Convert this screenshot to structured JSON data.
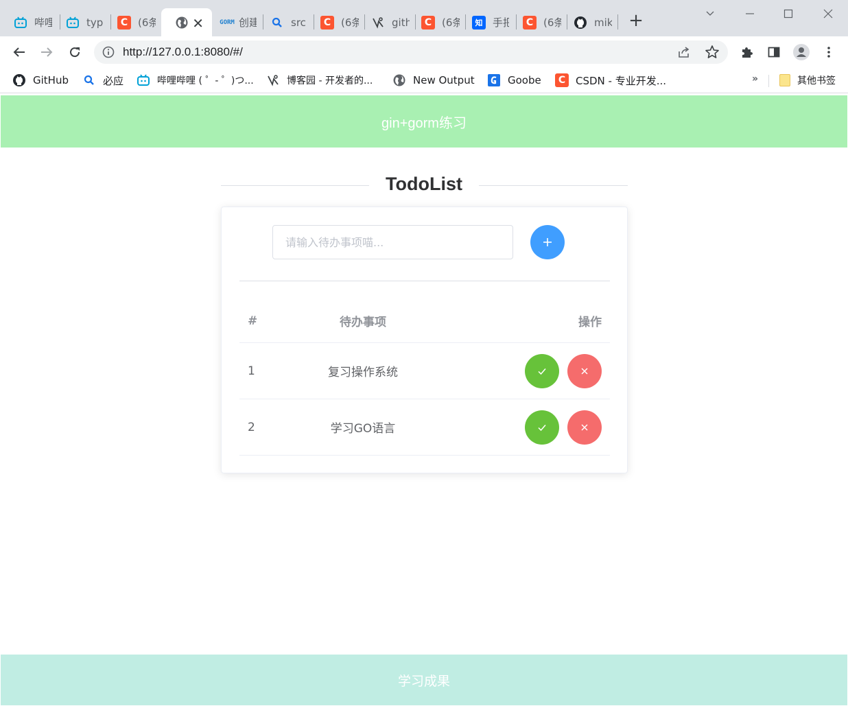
{
  "browser": {
    "tabs": [
      {
        "title": "哔哩",
        "icon": "bilibili-icon",
        "active": false
      },
      {
        "title": "typ",
        "icon": "bilibili-icon",
        "active": false
      },
      {
        "title": "(6条",
        "icon": "csdn-icon",
        "active": false
      },
      {
        "title": "",
        "icon": "globe-icon",
        "active": true
      },
      {
        "title": "创建",
        "icon": "gorm-icon",
        "active": false
      },
      {
        "title": "src",
        "icon": "search-icon",
        "active": false
      },
      {
        "title": "(6条",
        "icon": "csdn-icon",
        "active": false
      },
      {
        "title": "gith",
        "icon": "cnblogs-icon",
        "active": false
      },
      {
        "title": "(6条",
        "icon": "csdn-icon",
        "active": false
      },
      {
        "title": "手把",
        "icon": "zhihu-icon",
        "active": false
      },
      {
        "title": "(6条",
        "icon": "csdn-icon",
        "active": false
      },
      {
        "title": "mik",
        "icon": "github-icon",
        "active": false
      }
    ],
    "favicon_text": {
      "csdn": "C",
      "zhihu": "知",
      "gorm": "GORM"
    },
    "url": "http://127.0.0.1:8080/#/",
    "bookmarks": [
      {
        "label": "GitHub",
        "icon": "github-icon"
      },
      {
        "label": "必应",
        "icon": "search-icon"
      },
      {
        "label": "哔哩哔哩 ( ゜- ゜)つ...",
        "icon": "bilibili-icon"
      },
      {
        "label": "博客园 - 开发者的...",
        "icon": "cnblogs-icon"
      },
      {
        "label": "New Output",
        "icon": "globe-icon"
      },
      {
        "label": "Goobe",
        "icon": "goobe-icon"
      },
      {
        "label": "CSDN - 专业开发...",
        "icon": "csdn-icon"
      }
    ],
    "bookmarks_more": "»",
    "other_bookmarks": "其他书签"
  },
  "page": {
    "header_title": "gin+gorm练习",
    "footer_text": "学习成果",
    "todo_title": "TodoList",
    "input_placeholder": "请输入待办事项喵...",
    "table": {
      "headers": {
        "index": "#",
        "task": "待办事项",
        "ops": "操作"
      },
      "rows": [
        {
          "index": "1",
          "task": "复习操作系统"
        },
        {
          "index": "2",
          "task": "学习GO语言"
        }
      ]
    },
    "colors": {
      "header_bg": "#a9f0b2",
      "footer_bg": "#c0ede3",
      "primary": "#409eff",
      "success": "#67c23a",
      "danger": "#f56c6c"
    }
  }
}
